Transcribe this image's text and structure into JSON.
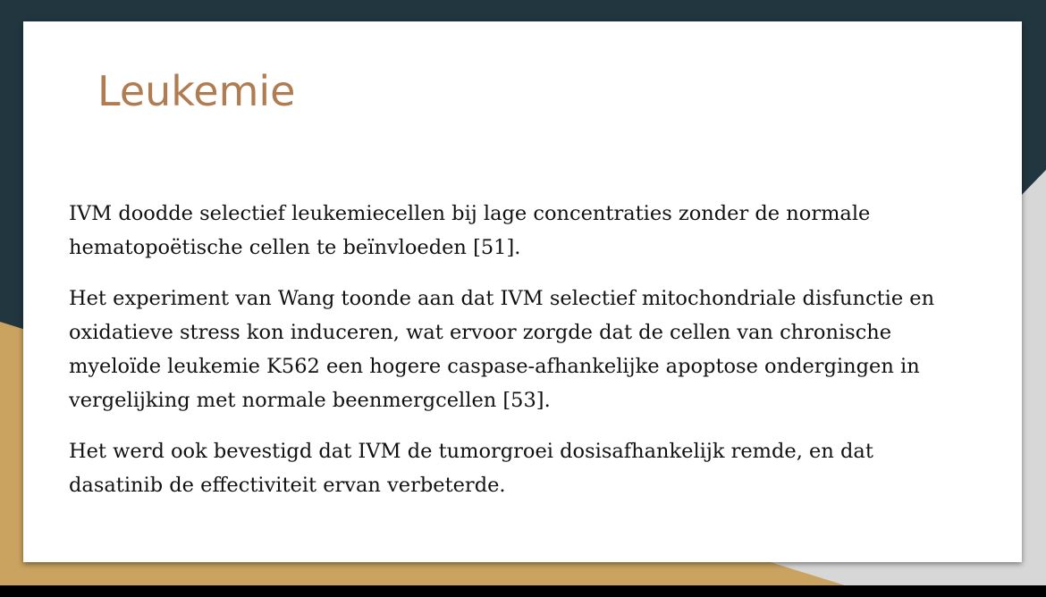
{
  "slide": {
    "title": "Leukemie",
    "paragraphs": [
      "IVM doodde selectief leukemiecellen bij lage concentraties zonder de normale hematopoëtische cellen te beïnvloeden [51].",
      "Het experiment van Wang toonde aan dat IVM selectief mitochondriale disfunctie en oxidatieve stress kon induceren, wat ervoor zorgde dat de cellen van chronische myeloïde leukemie K562 een hogere caspase-afhankelijke apoptose ondergingen in vergelijking met normale beenmergcellen [53].",
      "Het werd ook bevestigd dat IVM de tumorgroei dosisafhankelijk remde, en dat dasatinib de effectiviteit ervan verbeterde."
    ]
  },
  "theme": {
    "title_color": "#b07c52",
    "dark_background": "#223640",
    "gold_accent": "#c9a35f",
    "light_gray": "#d7d7d7",
    "card": "#ffffff"
  }
}
